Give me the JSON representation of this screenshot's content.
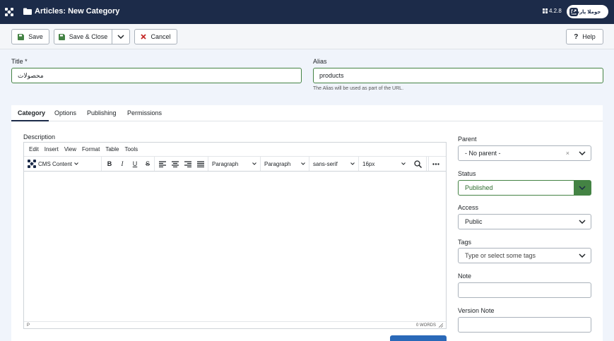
{
  "header": {
    "title": "Articles: New Category",
    "version": "4.2.8",
    "site_button_label": "جوملا پارسی"
  },
  "toolbar": {
    "save_label": "Save",
    "save_close_label": "Save & Close",
    "cancel_label": "Cancel",
    "help_label": "Help"
  },
  "form": {
    "title_label": "Title *",
    "title_value": "محصولات",
    "alias_label": "Alias",
    "alias_value": "products",
    "alias_hint": "The Alias will be used as part of the URL."
  },
  "tabs": [
    "Category",
    "Options",
    "Publishing",
    "Permissions"
  ],
  "editor": {
    "description_label": "Description",
    "menu": [
      "Edit",
      "Insert",
      "View",
      "Format",
      "Table",
      "Tools"
    ],
    "cms_content_label": "CMS Content",
    "block_format": "Paragraph",
    "paragraph_style": "Paragraph",
    "font_family": "sans-serif",
    "font_size": "16px",
    "status_path": "P",
    "word_count": "0 WORDS"
  },
  "sidebar": {
    "parent_label": "Parent",
    "parent_value": "- No parent -",
    "status_label": "Status",
    "status_value": "Published",
    "access_label": "Access",
    "access_value": "Public",
    "tags_label": "Tags",
    "tags_placeholder": "Type or select some tags",
    "note_label": "Note",
    "version_note_label": "Version Note"
  },
  "colors": {
    "header_bg": "#1c2b49",
    "success": "#448344",
    "primary": "#2a69b8",
    "danger": "#c52827"
  }
}
